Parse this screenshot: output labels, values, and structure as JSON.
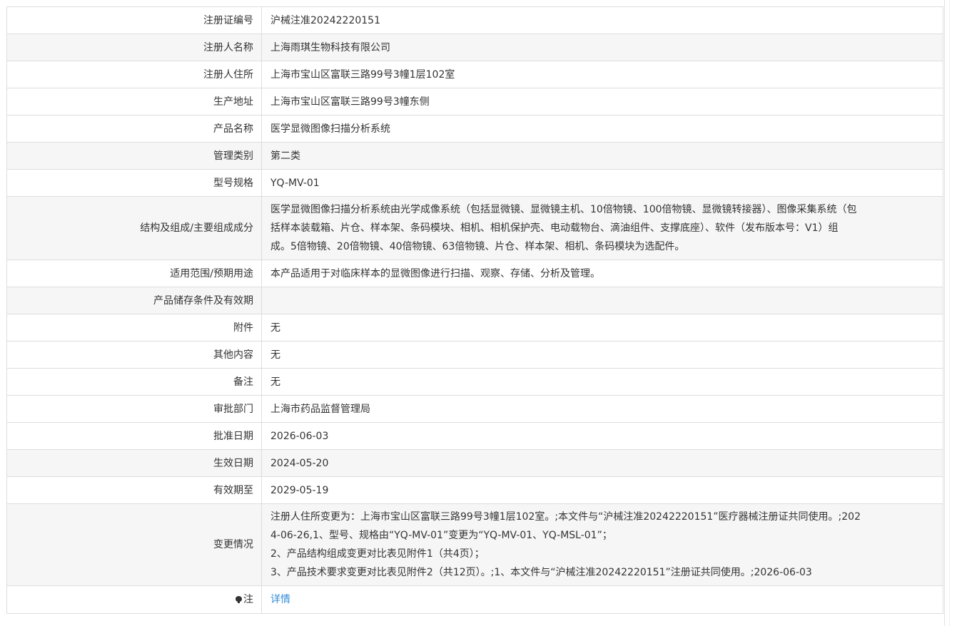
{
  "rows": [
    {
      "label": "注册证编号",
      "value": "沪械注准20242220151"
    },
    {
      "label": "注册人名称",
      "value": "上海雨琪生物科技有限公司"
    },
    {
      "label": "注册人住所",
      "value": "上海市宝山区富联三路99号3幢1层102室"
    },
    {
      "label": "生产地址",
      "value": "上海市宝山区富联三路99号3幢东侧"
    },
    {
      "label": "产品名称",
      "value": "医学显微图像扫描分析系统"
    },
    {
      "label": "管理类别",
      "value": "第二类"
    },
    {
      "label": "型号规格",
      "value": "YQ-MV-01"
    },
    {
      "label": "结构及组成/主要组成成分",
      "lines": [
        "医学显微图像扫描分析系统由光学成像系统（包括显微镜、显微镜主机、10倍物镜、100倍物镜、显微镜转接器）、图像采集系统（包",
        "括样本装载箱、片仓、样本架、条码模块、相机、相机保护壳、电动载物台、滴油组件、支撑底座）、软件（发布版本号：V1）组",
        "成。5倍物镜、20倍物镜、40倍物镜、63倍物镜、片仓、样本架、相机、条码模块为选配件。"
      ]
    },
    {
      "label": "适用范围/预期用途",
      "value": "本产品适用于对临床样本的显微图像进行扫描、观察、存储、分析及管理。"
    },
    {
      "label": "产品储存条件及有效期",
      "value": ""
    },
    {
      "label": "附件",
      "value": "无"
    },
    {
      "label": "其他内容",
      "value": "无"
    },
    {
      "label": "备注",
      "value": "无"
    },
    {
      "label": "审批部门",
      "value": "上海市药品监督管理局"
    },
    {
      "label": "批准日期",
      "value": "2026-06-03"
    },
    {
      "label": "生效日期",
      "value": "2024-05-20"
    },
    {
      "label": "有效期至",
      "value": "2029-05-19"
    },
    {
      "label": "变更情况",
      "lines": [
        "注册人住所变更为：上海市宝山区富联三路99号3幢1层102室。;本文件与“沪械注准20242220151”医疗器械注册证共同使用。;202",
        "4-06-26,1、型号、规格由“YQ-MV-01”变更为“YQ-MV-01、YQ-MSL-01”；",
        "2、产品结构组成变更对比表见附件1（共4页）；",
        "3、产品技术要求变更对比表见附件2（共12页）。;1、本文件与“沪械注准20242220151”注册证共同使用。;2026-06-03"
      ]
    }
  ],
  "note": {
    "icon": "lightbulb-icon",
    "label": "注",
    "link_text": "详情"
  }
}
